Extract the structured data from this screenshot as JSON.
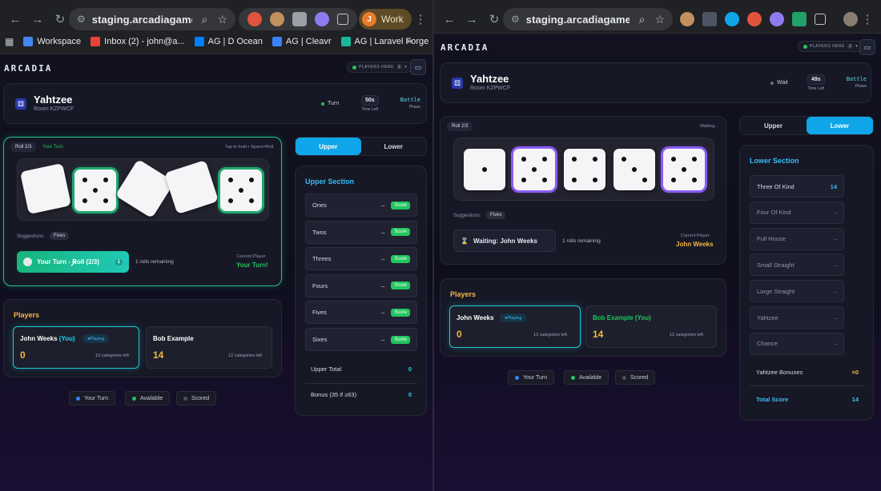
{
  "left": {
    "browser": {
      "url": "staging.arcadiagames...",
      "profile_label": "Work",
      "profile_initial": "J",
      "bookmarks": [
        {
          "label": "Workspace",
          "icon": "google-icon",
          "color": "#4285f4"
        },
        {
          "label": "Inbox (2) - john@a...",
          "icon": "gmail-icon",
          "color": "#ea4335"
        },
        {
          "label": "AG | D Ocean",
          "icon": "digitalocean-icon",
          "color": "#0080ff"
        },
        {
          "label": "AG | Cleavr",
          "icon": "cleavr-icon",
          "color": "#3b82f6"
        },
        {
          "label": "AG | Laravel Forge",
          "icon": "forge-icon",
          "color": "#19b69b"
        }
      ]
    },
    "app": {
      "logo": "ARCADIA",
      "players_here": "PLAYERS HERE",
      "players_count": "2",
      "game_title": "Yahtzee",
      "room": "Room KZPWCF",
      "status": "Turn",
      "timer": "50s",
      "timer_label": "Time Left",
      "phase": "Battle",
      "phase_label": "Phase",
      "roll_label": "Roll 2/3",
      "turn_badge": "Your Turn",
      "hint": "Tap to hold • Space=Roll",
      "suggestions_label": "Suggestions:",
      "suggestion": "Fives",
      "roll_button": "Your Turn - Roll (2/3)",
      "roll_button_count": "1",
      "rolls_remaining": "1 rolls remaining",
      "current_player_label": "Current Player",
      "current_player": "Your Turn!",
      "tab_upper": "Upper",
      "tab_lower": "Lower",
      "upper_section_title": "Upper Section",
      "upper_rows": [
        {
          "label": "Ones",
          "value": "–",
          "action": "Score"
        },
        {
          "label": "Twos",
          "value": "–",
          "action": "Score"
        },
        {
          "label": "Threes",
          "value": "–",
          "action": "Score"
        },
        {
          "label": "Fours",
          "value": "–",
          "action": "Score"
        },
        {
          "label": "Fives",
          "value": "–",
          "action": "Score"
        },
        {
          "label": "Sixes",
          "value": "–",
          "action": "Score"
        }
      ],
      "upper_total_label": "Upper Total",
      "upper_total": "0",
      "bonus_label": "Bonus (35 if ≥63)",
      "bonus": "0",
      "players_title": "Players",
      "players": [
        {
          "name": "John Weeks",
          "suffix": "(You)",
          "badge": "Playing",
          "score": "0",
          "left": "13 categories left"
        },
        {
          "name": "Bob Example",
          "suffix": "",
          "badge": "",
          "score": "14",
          "left": "12 categories left"
        }
      ],
      "legend": [
        {
          "label": "Your Turn",
          "color": "#3b82f6"
        },
        {
          "label": "Available",
          "color": "#22c55e"
        },
        {
          "label": "Scored",
          "color": "#4b4f63"
        }
      ]
    }
  },
  "right": {
    "browser": {
      "url": "staging.arcadiagames.c..."
    },
    "app": {
      "logo": "ARCADIA",
      "players_here": "PLAYERS HERE",
      "players_count": "2",
      "game_title": "Yahtzee",
      "room": "Room KZPWCF",
      "status": "Wait",
      "timer": "49s",
      "timer_label": "Time Left",
      "phase": "Battle",
      "phase_label": "Phase",
      "roll_label": "Roll 2/3",
      "waiting_label": "Waiting...",
      "suggestions_label": "Suggestions:",
      "suggestion": "Fives",
      "waiting_button": "Waiting: John Weeks",
      "rolls_remaining": "1 rolls remaining",
      "current_player_label": "Current Player",
      "current_player": "John Weeks",
      "tab_upper": "Upper",
      "tab_lower": "Lower",
      "lower_section_title": "Lower Section",
      "lower_rows": [
        {
          "label": "Three Of Kind",
          "value": "14"
        },
        {
          "label": "Four Of Kind",
          "value": "–"
        },
        {
          "label": "Full House",
          "value": "–"
        },
        {
          "label": "Small Straight",
          "value": "–"
        },
        {
          "label": "Large Straight",
          "value": "–"
        },
        {
          "label": "Yahtzee",
          "value": "–"
        },
        {
          "label": "Chance",
          "value": "–"
        }
      ],
      "yahtzee_bonus_label": "Yahtzee Bonuses",
      "yahtzee_bonus": "×0",
      "total_label": "Total Score",
      "total": "14",
      "players_title": "Players",
      "players": [
        {
          "name": "John Weeks",
          "suffix": "",
          "badge": "Playing",
          "score": "0",
          "left": "13 categories left"
        },
        {
          "name": "Bob Example",
          "suffix": "(You)",
          "badge": "",
          "score": "14",
          "left": "12 categories left"
        }
      ],
      "legend": [
        {
          "label": "Your Turn",
          "color": "#3b82f6"
        },
        {
          "label": "Available",
          "color": "#22c55e"
        },
        {
          "label": "Scored",
          "color": "#4b4f63"
        }
      ]
    }
  }
}
